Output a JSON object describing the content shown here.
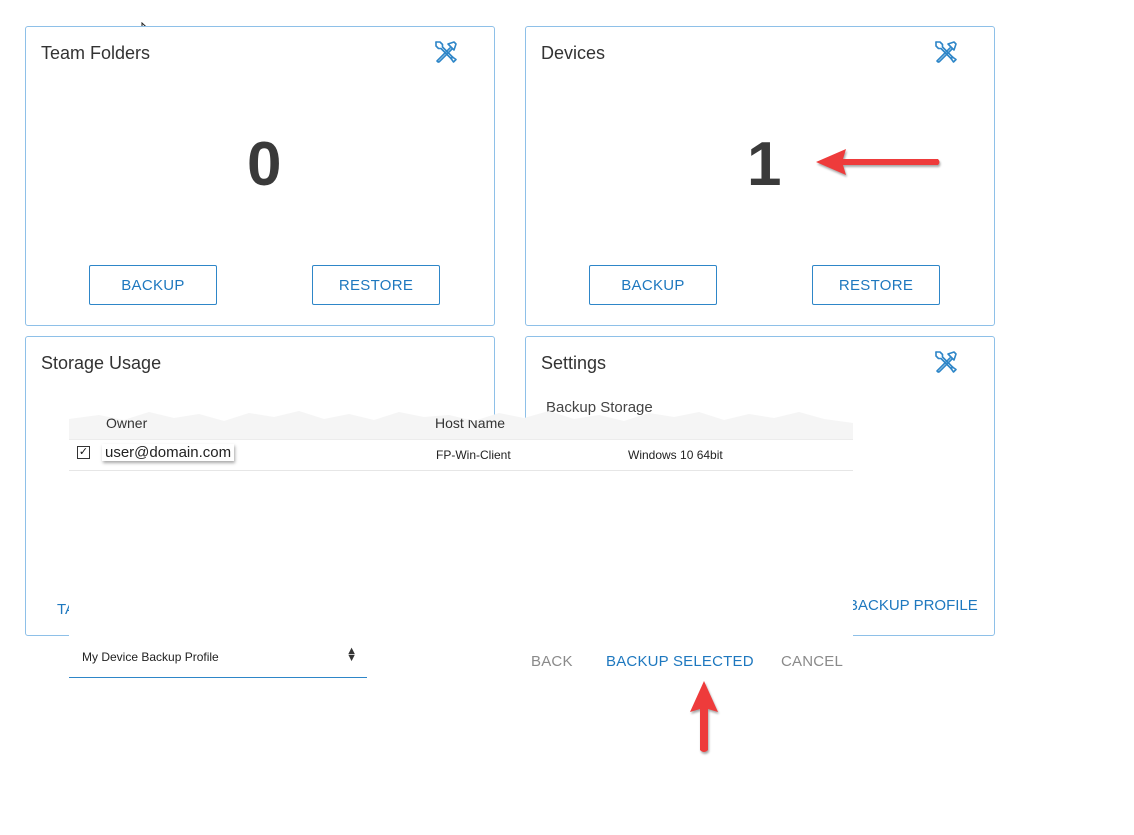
{
  "cards": {
    "team_folders": {
      "title": "Team Folders",
      "count": "0",
      "backup_label": "BACKUP",
      "restore_label": "RESTORE"
    },
    "devices": {
      "title": "Devices",
      "count": "1",
      "backup_label": "BACKUP",
      "restore_label": "RESTORE"
    },
    "storage_usage": {
      "title": "Storage Usage",
      "link_partial": "TA"
    },
    "settings": {
      "title": "Settings",
      "backup_storage_label": "Backup Storage",
      "link_label": "BACKUP PROFILE"
    }
  },
  "dialog": {
    "columns": {
      "owner": "Owner",
      "host_name": "Host Name"
    },
    "rows": [
      {
        "checked": true,
        "owner": "user@domain.com",
        "host_name": "FP-Win-Client",
        "os": "Windows 10 64bit"
      }
    ],
    "profile_select": {
      "value": "My Device Backup Profile"
    },
    "buttons": {
      "back": "BACK",
      "backup_selected": "BACKUP SELECTED",
      "cancel": "CANCEL"
    }
  },
  "colors": {
    "accent": "#1e78bf",
    "card_border": "#8ec0e8",
    "annotation_arrow": "#ee3b3b",
    "disabled_text": "#8a8a8a"
  },
  "icons": {
    "tools": "tools-icon",
    "cursor": "mouse-cursor-icon"
  }
}
